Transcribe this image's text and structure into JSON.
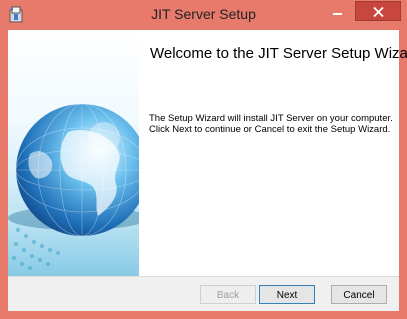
{
  "window": {
    "title": "JIT Server Setup",
    "app_icon": "installer-package-icon",
    "controls": {
      "minimize": "minimize-icon",
      "close": "close-icon"
    }
  },
  "wizard": {
    "heading": "Welcome to the JIT Server Setup Wizard",
    "body_lines": [
      "The Setup Wizard will install JIT Server on your computer.",
      "Click Next to continue or Cancel to exit the Setup Wizard."
    ],
    "banner_image": "globe-illustration"
  },
  "buttons": {
    "back": "Back",
    "next": "Next",
    "cancel": "Cancel"
  },
  "colors": {
    "window_frame": "#e87a6c",
    "close_button": "#c7463d",
    "footer": "#f0f0f0",
    "default_button_border": "#3c7fb1"
  }
}
